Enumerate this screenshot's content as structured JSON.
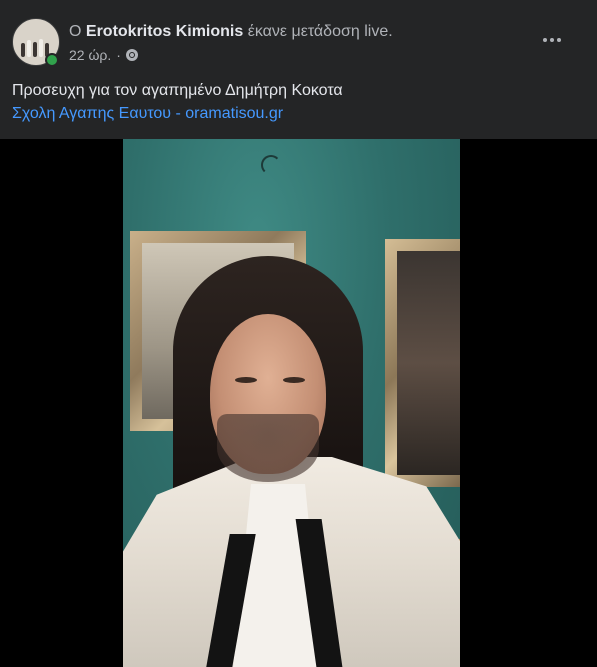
{
  "post": {
    "prefix": "Ο",
    "author": "Erotokritos Kimionis",
    "action": "έκανε μετάδοση live.",
    "time": "22 ώρ.",
    "separator": "·",
    "audience_icon": "globe-icon",
    "more_icon": "more-options-icon",
    "online_status_color": "#31a24c"
  },
  "caption": {
    "line1": "Προσευχη για τον αγαπημένο Δημήτρη Κοκοτα",
    "line2_text": "Σχολη Αγαπης Εαυτου - ",
    "line2_link": "oramatisou.gr",
    "link_color": "#4599ff"
  },
  "colors": {
    "background": "#242526",
    "video_letterbox": "#000000"
  }
}
